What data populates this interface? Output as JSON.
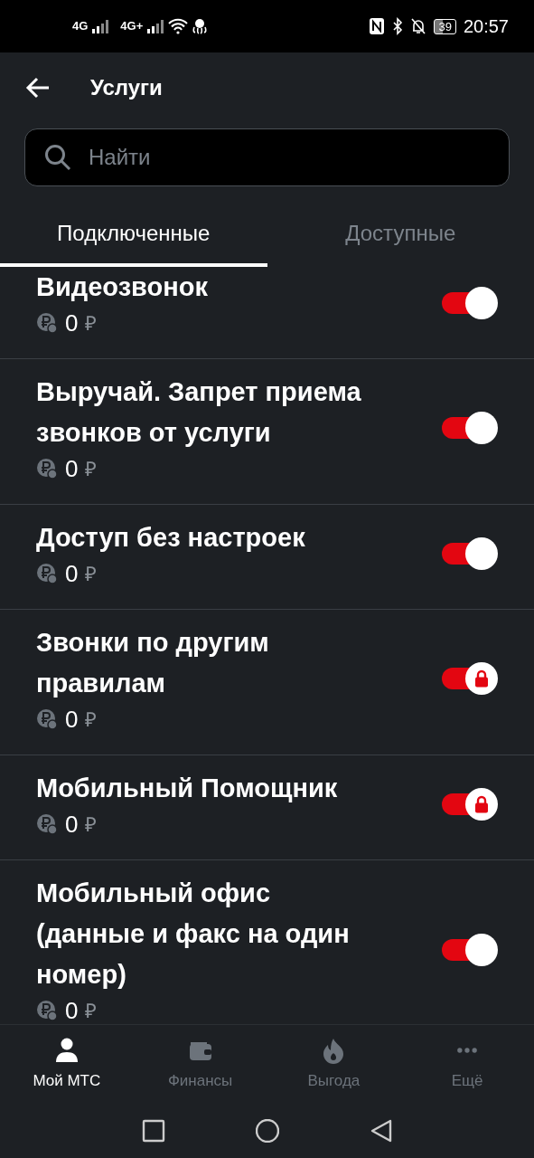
{
  "status_bar": {
    "sim1": "4G",
    "sim2": "4G+",
    "battery": "39",
    "time": "20:57"
  },
  "header": {
    "title": "Услуги"
  },
  "search": {
    "placeholder": "Найти"
  },
  "tabs": [
    {
      "label": "Подключенные",
      "selected": true
    },
    {
      "label": "Доступные",
      "selected": false
    }
  ],
  "services": [
    {
      "title": "Видеозвонок",
      "price": "0",
      "currency": "₽",
      "on": true,
      "locked": false
    },
    {
      "title": "Выручай. Запрет приема звонков от услуги",
      "price": "0",
      "currency": "₽",
      "on": true,
      "locked": false
    },
    {
      "title": "Доступ без настроек",
      "price": "0",
      "currency": "₽",
      "on": true,
      "locked": false
    },
    {
      "title": "Звонки по другим правилам",
      "price": "0",
      "currency": "₽",
      "on": true,
      "locked": true
    },
    {
      "title": "Мобильный Помощник",
      "price": "0",
      "currency": "₽",
      "on": true,
      "locked": true
    },
    {
      "title": "Мобильный офис (данные и факс на один номер)",
      "price": "0",
      "currency": "₽",
      "on": true,
      "locked": false
    }
  ],
  "bottom_nav": [
    {
      "label": "Мой МТС",
      "kind": "person",
      "selected": true
    },
    {
      "label": "Финансы",
      "kind": "wallet",
      "selected": false
    },
    {
      "label": "Выгода",
      "kind": "flame",
      "selected": false
    },
    {
      "label": "Ещё",
      "kind": "more",
      "selected": false
    }
  ]
}
